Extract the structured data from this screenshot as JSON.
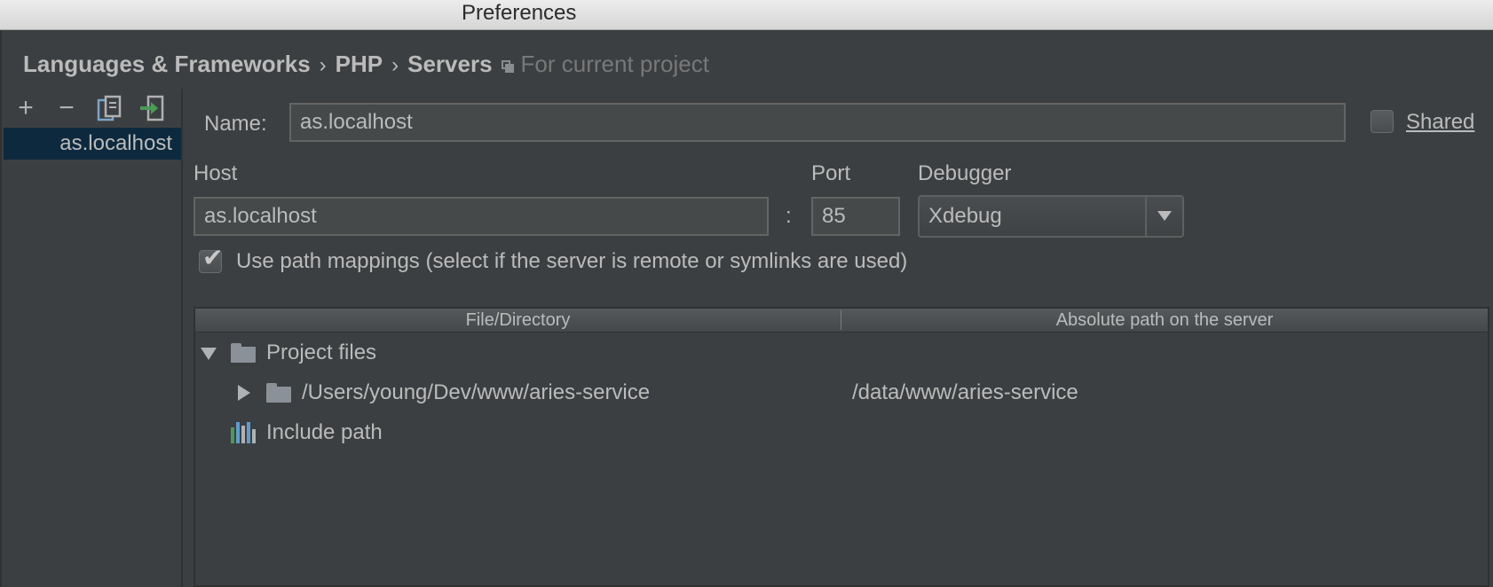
{
  "window": {
    "title": "Preferences"
  },
  "breadcrumb": {
    "items": [
      "Languages & Frameworks",
      "PHP",
      "Servers"
    ],
    "separator": "›",
    "scope": "For current project"
  },
  "servers": {
    "toolbar": {
      "add": "+",
      "remove": "−"
    },
    "items": [
      {
        "label": "as.localhost",
        "selected": true
      }
    ]
  },
  "form": {
    "name_label": "Name:",
    "name_value": "as.localhost",
    "shared_label": "Shared",
    "shared_checked": false,
    "host_label": "Host",
    "host_value": "as.localhost",
    "colon": ":",
    "port_label": "Port",
    "port_value": "85",
    "debugger_label": "Debugger",
    "debugger_value": "Xdebug",
    "path_mappings_label": "Use path mappings (select if the server is remote or symlinks are used)",
    "path_mappings_checked": true
  },
  "mappings": {
    "columns": [
      "File/Directory",
      "Absolute path on the server"
    ],
    "rows": [
      {
        "label": "Project files",
        "expanded": true,
        "icon": "folder-icon",
        "server_path": ""
      },
      {
        "label": "/Users/young/Dev/www/aries-service",
        "expanded": false,
        "icon": "folder-icon",
        "server_path": "/data/www/aries-service"
      },
      {
        "label": "Include path",
        "icon": "library-icon",
        "server_path": ""
      }
    ]
  },
  "colors": {
    "background": "#3c3f41",
    "selection": "#0d293e",
    "text": "#bbbbbb",
    "muted": "#787878",
    "green": "#499c54"
  }
}
